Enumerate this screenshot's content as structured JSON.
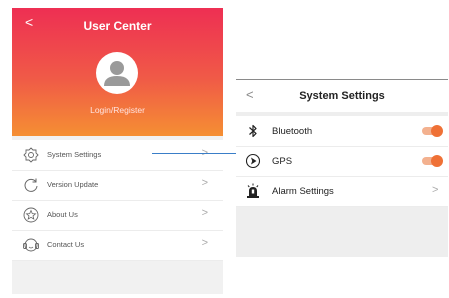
{
  "user_center": {
    "title": "User Center",
    "back_glyph": "<",
    "avatar_icon": "user-avatar-icon",
    "login_register": "Login/Register",
    "menu": [
      {
        "icon": "settings-gear-icon",
        "label": "System Settings",
        "chevron": ">"
      },
      {
        "icon": "refresh-cycle-icon",
        "label": "Version Update",
        "chevron": ">"
      },
      {
        "icon": "star-badge-icon",
        "label": "About Us",
        "chevron": ">"
      },
      {
        "icon": "headset-icon",
        "label": "Contact Us",
        "chevron": ">"
      }
    ]
  },
  "system_settings": {
    "title": "System Settings",
    "back_glyph": "<",
    "items": [
      {
        "icon": "bluetooth-icon",
        "label": "Bluetooth",
        "toggle_on": true
      },
      {
        "icon": "gps-icon",
        "label": "GPS",
        "toggle_on": true
      },
      {
        "icon": "alarm-siren-icon",
        "label": "Alarm Settings",
        "chevron": ">"
      }
    ]
  },
  "colors": {
    "header_gradient_top": "#ee2f53",
    "header_gradient_bottom": "#f58f33",
    "toggle_accent": "#ef7136",
    "connector_line": "#3a7ec8"
  }
}
